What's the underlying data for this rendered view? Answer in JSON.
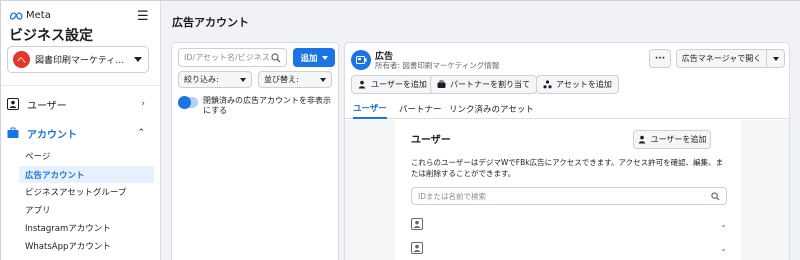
{
  "sidebar": {
    "brand": "Meta",
    "title": "ビジネス設定",
    "business": {
      "initial": "へ",
      "name": "図書印刷マーケティング..."
    },
    "nav": [
      {
        "label": "ユーザー",
        "icon": "users-icon"
      },
      {
        "label": "アカウント",
        "icon": "briefcase-icon",
        "active": true
      }
    ],
    "sub_items": [
      {
        "label": "ページ"
      },
      {
        "label": "広告アカウント",
        "selected": true
      },
      {
        "label": "ビジネスアセットグループ"
      },
      {
        "label": "アプリ"
      },
      {
        "label": "Instagramアカウント"
      },
      {
        "label": "WhatsAppアカウント"
      }
    ]
  },
  "main": {
    "title": "広告アカウント",
    "list": {
      "search_placeholder": "ID/アセット名/ビジネス...",
      "add_label": "追加",
      "filter_label": "絞り込み:",
      "sort_label": "並び替え:",
      "toggle_label": "閉鎖済みの広告アカウントを非表示にする"
    },
    "detail": {
      "account_name": "広告",
      "owner": "所有者: 図書印刷マーケティング情報",
      "more_label": "···",
      "open_label": "広告マネージャで開く",
      "actions": [
        {
          "label": "ユーザーを追加",
          "icon": "add-user-icon"
        },
        {
          "label": "パートナーを割り当て",
          "icon": "partner-icon"
        },
        {
          "label": "アセットを追加",
          "icon": "asset-icon"
        }
      ],
      "tabs": [
        {
          "label": "ユーザー",
          "active": true
        },
        {
          "label": "パートナー"
        },
        {
          "label": "リンク済みのアセット"
        }
      ],
      "users": {
        "title": "ユーザー",
        "add_label": "ユーザーを追加",
        "description": "これらのユーザーはデジマWでFBk広告にアクセスできます。アクセス許可を確認、編集、または削除することができます。",
        "search_placeholder": "IDまたは名前で検索"
      }
    }
  },
  "colors": {
    "accent": "#1b74e4",
    "brand_avatar": "#e4362b",
    "selected_bg": "#e7f0fd"
  }
}
